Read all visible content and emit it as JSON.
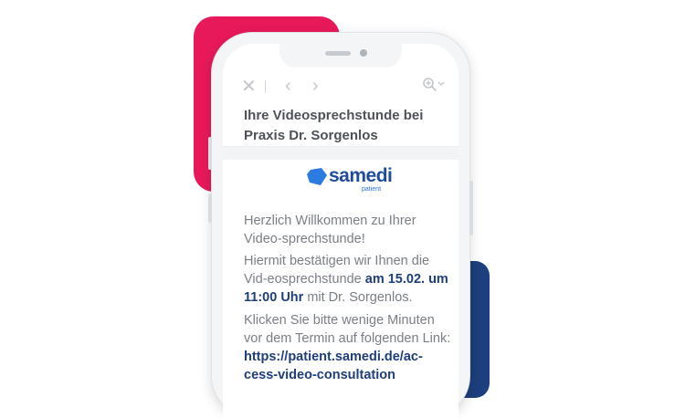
{
  "email": {
    "subject": "Ihre Videosprechstunde bei Praxis Dr. Sorgenlos",
    "logo": {
      "wordmark": "samedi",
      "sub": "patient"
    },
    "greeting": "Herzlich Willkommen zu Ihrer Video-sprechstunde!",
    "confirm": {
      "pre": "Hiermit bestätigen wir Ihnen die Vid-eosprechstunde ",
      "highlight": "am 15.02. um 11:00 Uhr",
      "post": " mit Dr. Sorgenlos."
    },
    "link_intro": "Klicken Sie bitte wenige Minuten vor dem Termin auf folgenden Link:",
    "link": "https://patient.samedi.de/ac-cess-video-consultation"
  },
  "toolbar": {
    "close_icon": "close-icon",
    "prev_icon": "chevron-left-icon",
    "next_icon": "chevron-right-icon",
    "zoom_icon": "zoom-icon"
  },
  "colors": {
    "pink": "#e8195a",
    "navy": "#1d3f7d",
    "brand_blue": "#2b6fd6",
    "text": "#7a7f86",
    "highlight": "#1f3e7a"
  }
}
